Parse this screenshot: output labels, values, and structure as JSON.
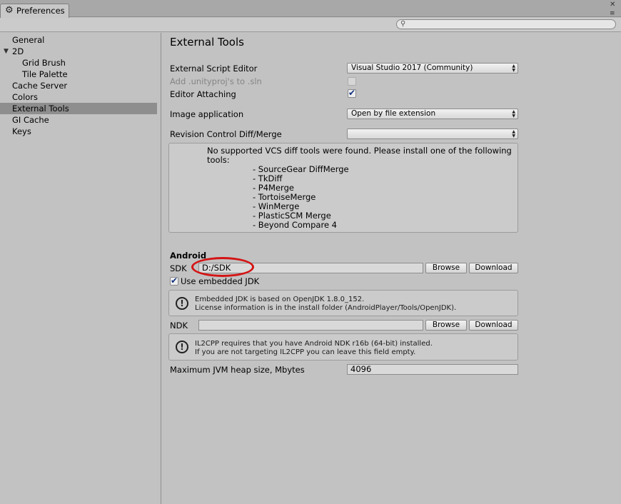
{
  "window": {
    "tab_title": "Preferences",
    "close_glyph": "✕",
    "menu_glyph": "≡",
    "search_placeholder": ""
  },
  "sidebar": {
    "items": [
      {
        "label": "General"
      },
      {
        "label": "2D",
        "expanded": true
      },
      {
        "label": "Grid Brush"
      },
      {
        "label": "Tile Palette"
      },
      {
        "label": "Cache Server"
      },
      {
        "label": "Colors"
      },
      {
        "label": "External Tools",
        "selected": true
      },
      {
        "label": "GI Cache"
      },
      {
        "label": "Keys"
      }
    ]
  },
  "main": {
    "title": "External Tools",
    "script_editor": {
      "label": "External Script Editor",
      "value": "Visual Studio 2017 (Community)"
    },
    "add_unityproj": {
      "label": "Add .unityproj's to .sln",
      "checked": false,
      "enabled": false
    },
    "editor_attaching": {
      "label": "Editor Attaching",
      "checked": true
    },
    "image_app": {
      "label": "Image application",
      "value": "Open by file extension"
    },
    "revision_control": {
      "label": "Revision Control Diff/Merge",
      "value": ""
    },
    "vcs_message": {
      "line1": "No supported VCS diff tools were found. Please install one of the following",
      "line2": "tools:",
      "tools": [
        "- SourceGear DiffMerge",
        "- TkDiff",
        "- P4Merge",
        "- TortoiseMerge",
        "- WinMerge",
        "- PlasticSCM Merge",
        "- Beyond Compare 4"
      ]
    },
    "android": {
      "heading": "Android",
      "sdk": {
        "label": "SDK",
        "value": "D:/SDK",
        "browse": "Browse",
        "download": "Download"
      },
      "use_embedded_jdk": {
        "label": "Use embedded JDK",
        "checked": true
      },
      "jdk_info": {
        "line1": "Embedded JDK is based on OpenJDK 1.8.0_152.",
        "line2": "License information is in the install folder (AndroidPlayer/Tools/OpenJDK)."
      },
      "ndk": {
        "label": "NDK",
        "value": "",
        "browse": "Browse",
        "download": "Download"
      },
      "ndk_info": {
        "line1": "IL2CPP requires that you have Android NDK r16b (64-bit) installed.",
        "line2": "If you are not targeting IL2CPP you can leave this field empty."
      },
      "jvm_heap": {
        "label": "Maximum JVM heap size, Mbytes",
        "value": "4096"
      }
    }
  },
  "colors": {
    "annotation_ellipse": "#d41414",
    "checkmark": "#11327f",
    "selection": "#8e8e8e"
  }
}
